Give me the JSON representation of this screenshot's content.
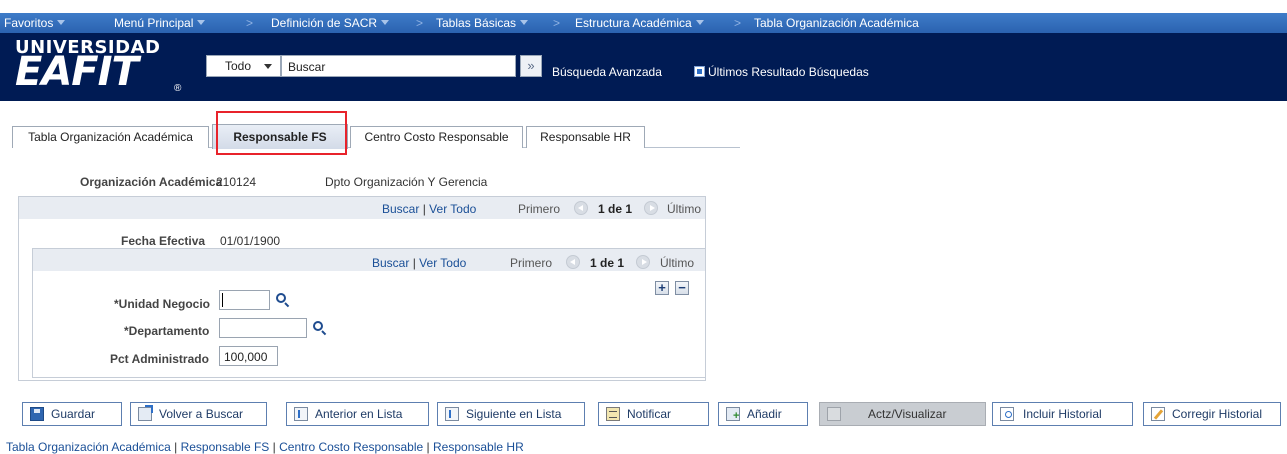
{
  "top_nav": {
    "favorites": "Favoritos",
    "main_menu": "Menú Principal",
    "breadcrumb": [
      "Definición de SACR",
      "Tablas Básicas",
      "Estructura Académica",
      "Tabla Organización Académica"
    ],
    "separator": ">"
  },
  "header": {
    "logo_top": "UNIVERSIDAD",
    "logo_main": "EAFIT",
    "logo_reg": "®",
    "search_scope": "Todo",
    "search_input": "Buscar",
    "search_go": "»",
    "advanced_search": "Búsqueda Avanzada",
    "last_results": "Últimos Resultado Búsquedas"
  },
  "tabs": [
    {
      "label": "Tabla Organización Académica",
      "active": false
    },
    {
      "label": "Responsable FS",
      "active": true
    },
    {
      "label": "Centro Costo Responsable",
      "active": false
    },
    {
      "label": "Responsable HR",
      "active": false
    }
  ],
  "content": {
    "org_label": "Organización Académica",
    "org_value": "210124",
    "org_description": "Dpto Organización Y Gerencia",
    "outer_nav": {
      "find": "Buscar",
      "view_all": "Ver Todo",
      "first": "Primero",
      "count": "1 de 1",
      "last": "Último",
      "pipe": "|"
    },
    "effdt_label": "Fecha Efectiva",
    "effdt_value": "01/01/1900",
    "inner_nav": {
      "find": "Buscar",
      "view_all": "Ver Todo",
      "first": "Primero",
      "count": "1 de 1",
      "last": "Último",
      "pipe": "|"
    },
    "add_row": "+",
    "delete_row": "−",
    "business_unit_label": "*Unidad Negocio",
    "business_unit_value": "",
    "department_label": "*Departamento",
    "department_value": "",
    "pct_label": "Pct Administrado",
    "pct_value": "100,000"
  },
  "toolbar": {
    "save": "Guardar",
    "return_search": "Volver a Buscar",
    "previous": "Anterior en Lista",
    "next": "Siguiente en Lista",
    "notify": "Notificar",
    "add": "Añadir",
    "update_display": "Actz/Visualizar",
    "include_history": "Incluir Historial",
    "correct_history": "Corregir Historial"
  },
  "footer_links": [
    "Tabla Organización Académica",
    "Responsable FS",
    "Centro Costo Responsable",
    "Responsable HR"
  ]
}
